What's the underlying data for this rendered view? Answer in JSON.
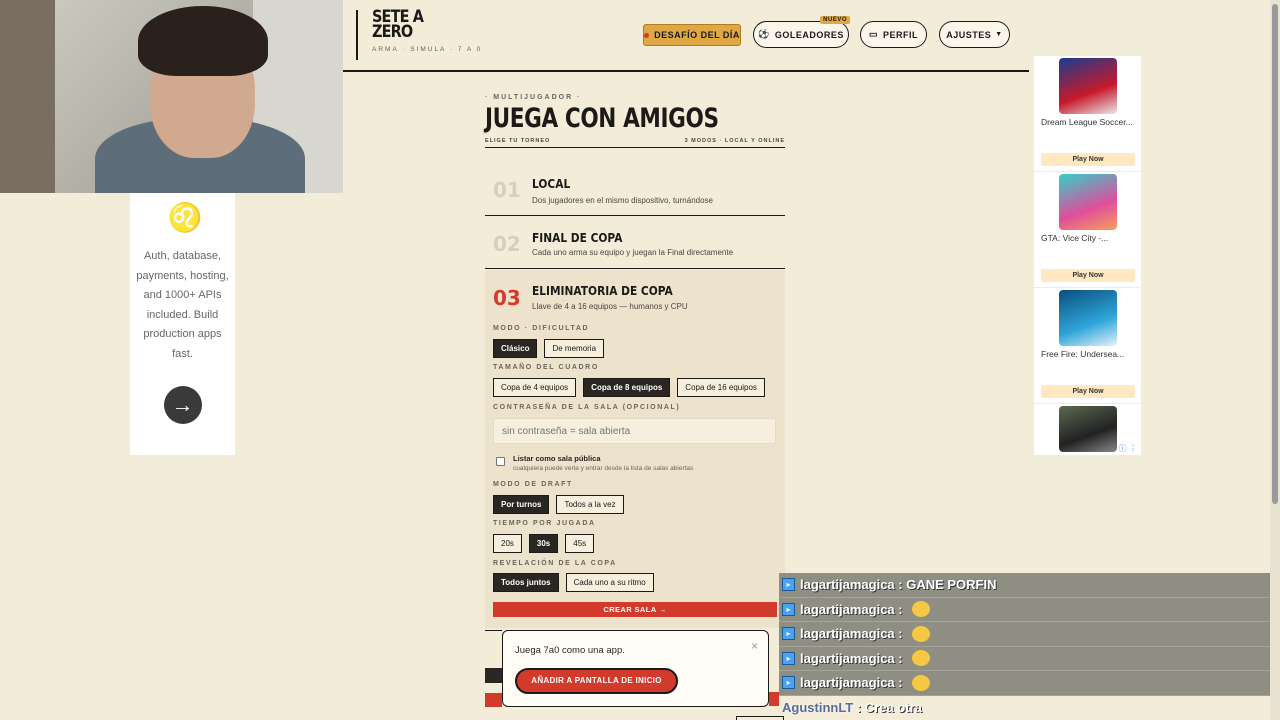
{
  "ad_left": {
    "text": "Auth, database, payments, hosting, and 1000+ APIs included. Build production apps fast."
  },
  "header": {
    "logo_title": "SETE A ZERO",
    "logo_sub": "ARMA · SIMULA · 7 A 0",
    "nav": {
      "challenge": "DESAFÍO DEL DÍA",
      "scorers": "GOLEADORES",
      "scorers_badge": "NUEVO",
      "profile": "PERFIL",
      "settings": "AJUSTES"
    }
  },
  "main": {
    "eyebrow": "· MULTIJUGADOR ·",
    "title": "JUEGA CON AMIGOS",
    "sub_left": "ELIGE TU TORNEO",
    "sub_right": "3 MODOS · LOCAL Y ONLINE",
    "modes": [
      {
        "num": "01",
        "name": "LOCAL",
        "desc": "Dos jugadores en el mismo dispositivo, turnándose"
      },
      {
        "num": "02",
        "name": "FINAL DE COPA",
        "desc": "Cada uno arma su equipo y juegan la Final directamente"
      },
      {
        "num": "03",
        "name": "ELIMINATORIA DE COPA",
        "desc": "Llave de 4 a 16 equipos — humanos y CPU"
      }
    ],
    "form": {
      "difficulty_label": "MODO · DIFICULTAD",
      "difficulty_options": [
        "Clásico",
        "De memoria"
      ],
      "size_label": "TAMAÑO DEL CUADRO",
      "size_options": [
        "Copa de 4 equipos",
        "Copa de 8 equipos",
        "Copa de 16 equipos"
      ],
      "password_label": "CONTRASEÑA DE LA SALA (OPCIONAL)",
      "password_placeholder": "sin contraseña = sala abierta",
      "public_title": "Listar como sala pública",
      "public_desc": "cualquiera puede verla y entrar desde la lista de salas abiertas",
      "draft_label": "MODO DE DRAFT",
      "draft_options": [
        "Por turnos",
        "Todos a la vez"
      ],
      "time_label": "TIEMPO POR JUGADA",
      "time_options": [
        "20s",
        "30s",
        "45s"
      ],
      "reveal_label": "REVELACIÓN DE LA COPA",
      "reveal_options": [
        "Todos juntos",
        "Cada uno a su ritmo"
      ],
      "create": "CREAR SALA →"
    }
  },
  "popup": {
    "text": "Juega 7a0 como una app.",
    "button": "AÑADIR A PANTALLA DE INICIO",
    "close": "×"
  },
  "ad_right": {
    "apps": [
      {
        "name": "Dream League Soccer...",
        "play": "Play Now"
      },
      {
        "name": "GTA: Vice City -...",
        "play": "Play Now"
      },
      {
        "name": "Free Fire: Undersea...",
        "play": "Play Now"
      }
    ]
  },
  "chat": [
    {
      "user": "lagartijamagica",
      "msg": " : GANE PORFIN"
    },
    {
      "user": "lagartijamagica",
      "msg": " : "
    },
    {
      "user": "lagartijamagica",
      "msg": " : "
    },
    {
      "user": "lagartijamagica",
      "msg": " : "
    },
    {
      "user": "lagartijamagica",
      "msg": " : "
    },
    {
      "user": "AgustinnLT",
      "msg": " : Crea otra"
    }
  ],
  "colors": {
    "accent": "#d23b2c",
    "gold": "#e0a844",
    "bg": "#f3ecd9"
  }
}
